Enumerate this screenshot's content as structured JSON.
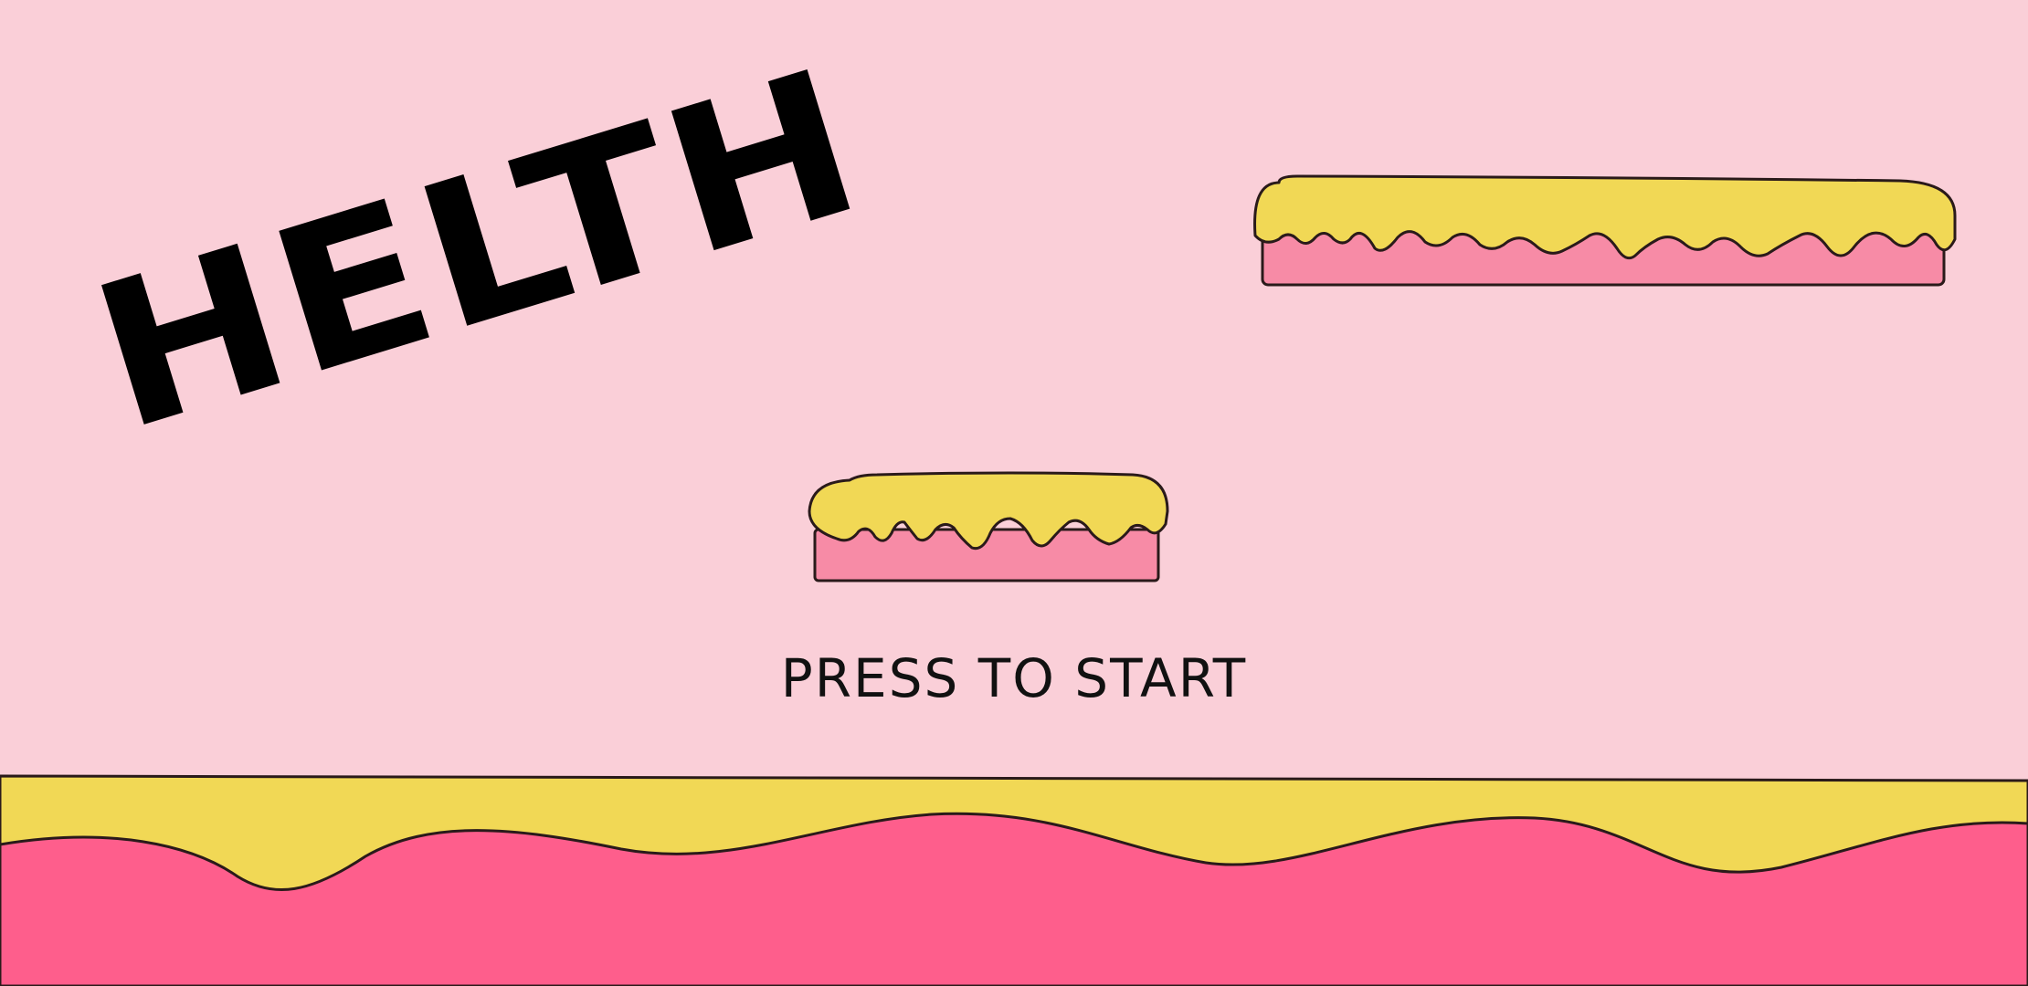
{
  "game": {
    "title": "HELTH",
    "start_prompt": "PRESS TO START"
  },
  "colors": {
    "background": "#FACFD8",
    "icing": "#F1D855",
    "cake": "#F78BA6",
    "ground_cake": "#FE5E8C",
    "outline": "#2A1A1A",
    "text": "#000000"
  },
  "icons": {
    "platform": "cake-platform-icon",
    "ground": "cake-ground-icon"
  }
}
